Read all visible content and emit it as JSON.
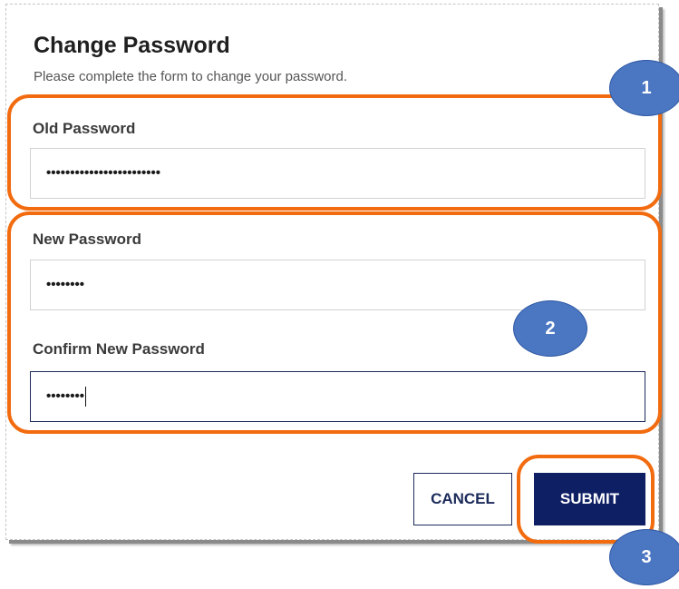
{
  "dialog": {
    "title": "Change Password",
    "subtitle": "Please complete the form to change your password."
  },
  "fields": {
    "old_password": {
      "label": "Old Password",
      "masked_value": "••••••••••••••••••••••••"
    },
    "new_password": {
      "label": "New Password",
      "masked_value": "••••••••"
    },
    "confirm_password": {
      "label": "Confirm New Password",
      "masked_value": "••••••••"
    }
  },
  "buttons": {
    "cancel_label": "CANCEL",
    "submit_label": "SUBMIT"
  },
  "annotations": {
    "badge_1": "1",
    "badge_2": "2",
    "badge_3": "3"
  },
  "colors": {
    "accent_navy": "#0f1f64",
    "annotation_orange": "#f26b0f",
    "badge_blue": "#4a76c2"
  }
}
